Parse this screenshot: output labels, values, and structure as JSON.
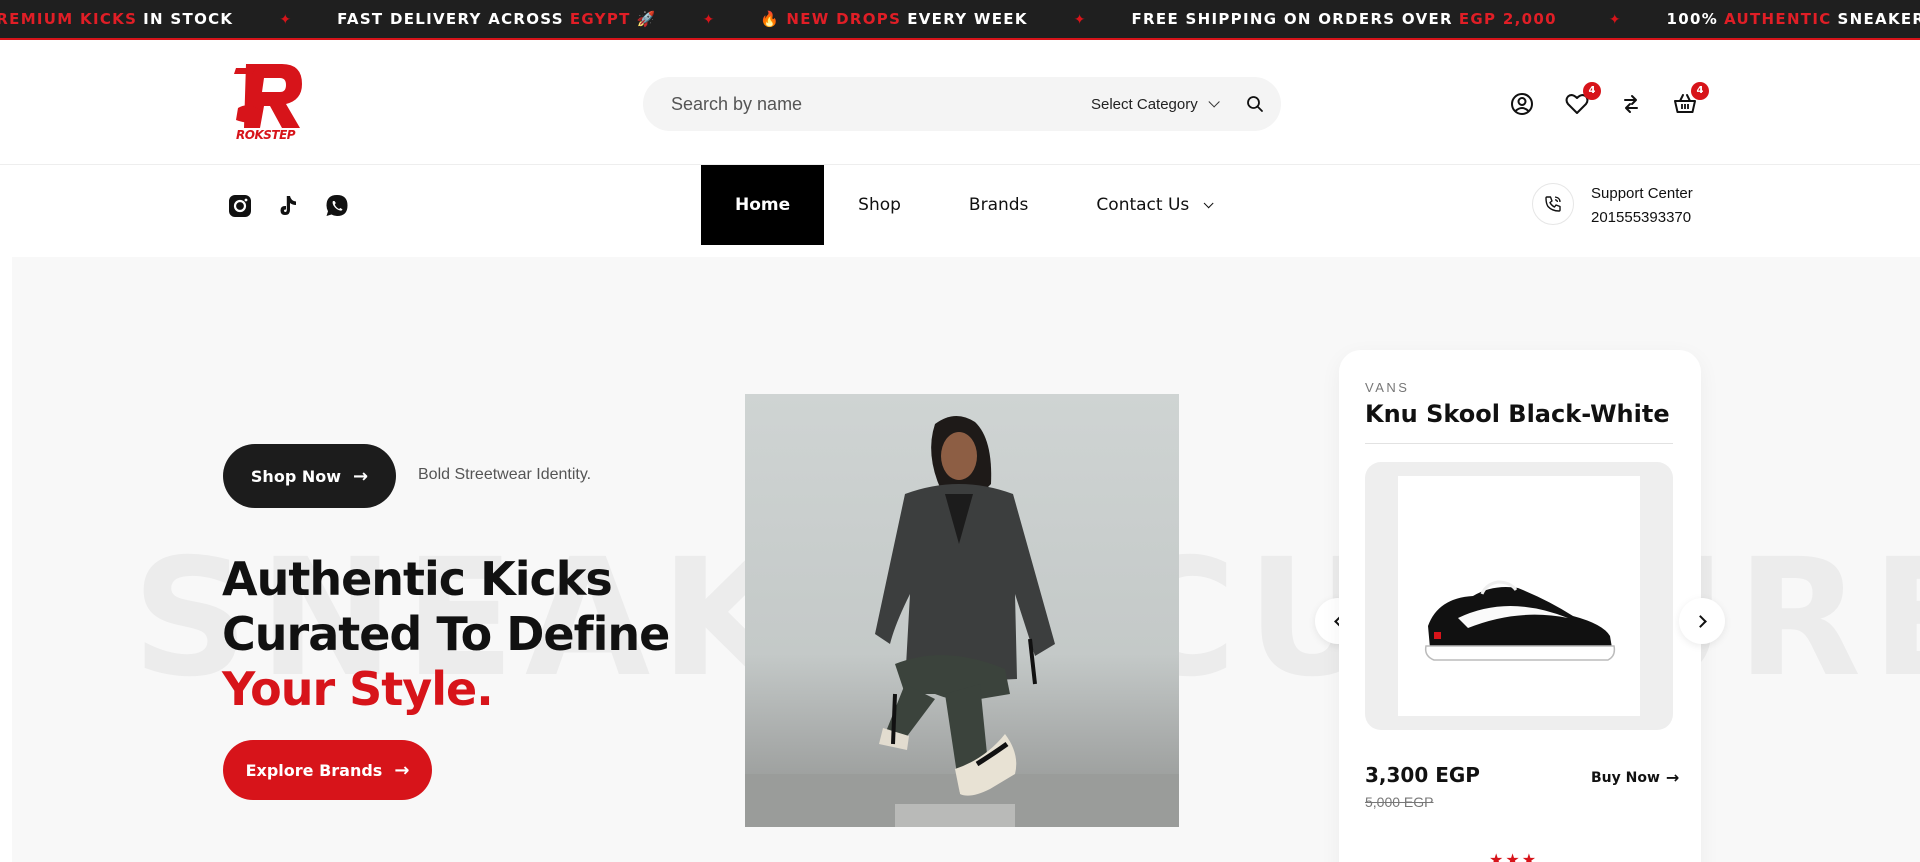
{
  "marquee": {
    "items": [
      {
        "pre": "",
        "red": "PREMIUM KICKS",
        "post": "IN STOCK"
      },
      {
        "pre": "FAST DELIVERY ACROSS",
        "red": "EGYPT",
        "post": "🚀"
      },
      {
        "pre": "🔥",
        "red": "NEW DROPS",
        "post": "EVERY WEEK"
      },
      {
        "pre": "FREE SHIPPING ON ORDERS OVER",
        "red": "EGP 2,000",
        "post": ""
      },
      {
        "pre": "100%",
        "red": "AUTHENTIC",
        "post": "SNEAKERS"
      }
    ],
    "separator": "✦"
  },
  "header": {
    "logo_text": "ROKSTEP",
    "search_placeholder": "Search by name",
    "category_label": "Select Category",
    "wishlist_count": "4",
    "cart_count": "4",
    "icons": [
      "user-icon",
      "heart-icon",
      "compare-icon",
      "basket-icon",
      "search-icon"
    ]
  },
  "nav": {
    "social": [
      "instagram-icon",
      "tiktok-icon",
      "whatsapp-icon"
    ],
    "items": [
      {
        "label": "Home",
        "active": true
      },
      {
        "label": "Shop",
        "active": false
      },
      {
        "label": "Brands",
        "active": false
      },
      {
        "label": "Contact Us",
        "active": false,
        "dropdown": true
      }
    ],
    "support_title": "Support Center",
    "support_phone": "201555393370"
  },
  "hero": {
    "bg_word": "SNEAKER CULTURE",
    "shop_now_label": "Shop Now",
    "tagline": "Bold Streetwear Identity.",
    "headline_1": "Authentic Kicks",
    "headline_2": "Curated To Define",
    "headline_3": "Your Style.",
    "explore_label": "Explore Brands"
  },
  "product": {
    "brand": "VANS",
    "title": "Knu Skool Black-White",
    "price": "3,300 EGP",
    "old_price": "5,000 EGP",
    "buy_label": "Buy Now"
  },
  "colors": {
    "accent": "#d7141a",
    "dark": "#1c1c1c",
    "marquee_bg": "#1f1f1f"
  }
}
